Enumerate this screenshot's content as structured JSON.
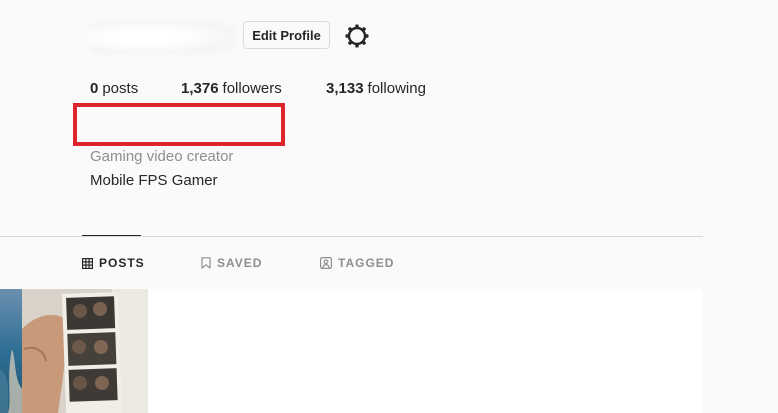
{
  "profile": {
    "edit_button": "Edit Profile",
    "settings_icon": "gear-icon",
    "category": "Gaming video creator",
    "bio": "Mobile FPS Gamer"
  },
  "stats": {
    "posts_count": "0",
    "posts_label": "posts",
    "followers_count": "1,376",
    "followers_label": "followers",
    "following_count": "3,133",
    "following_label": "following"
  },
  "tabs": [
    {
      "label": "POSTS",
      "icon": "grid-icon",
      "active": true
    },
    {
      "label": "SAVED",
      "icon": "bookmark-icon",
      "active": false
    },
    {
      "label": "TAGGED",
      "icon": "tag-person-icon",
      "active": false
    }
  ],
  "colors": {
    "redaction_border": "#e0242b",
    "text_primary": "#262626",
    "text_secondary": "#8e8e8e",
    "border": "#dbdbdb"
  }
}
